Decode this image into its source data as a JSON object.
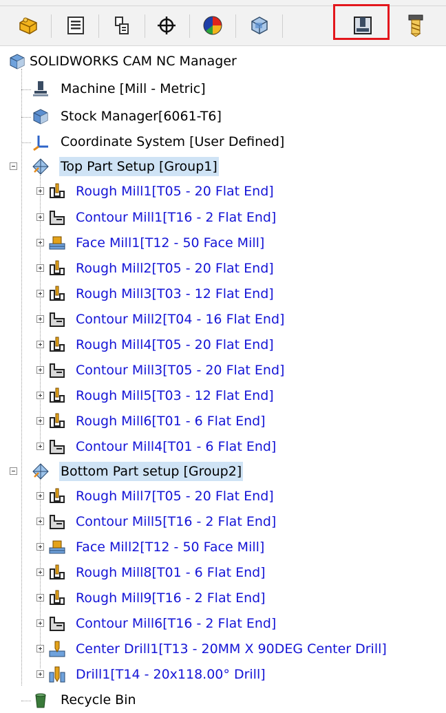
{
  "toolbar": {
    "tabs": [
      {
        "name": "feature-manager-tab",
        "icon": "puzzle-icon",
        "active": false
      },
      {
        "name": "property-manager-tab",
        "icon": "property-list-icon",
        "active": false
      },
      {
        "name": "configuration-manager-tab",
        "icon": "configuration-icon",
        "active": false
      },
      {
        "name": "dimxpert-manager-tab",
        "icon": "crosshair-icon",
        "active": false
      },
      {
        "name": "display-manager-tab",
        "icon": "color-pie-icon",
        "active": false
      },
      {
        "name": "cam-feature-tree-tab",
        "icon": "cam-feature-tree-icon",
        "active": false
      },
      {
        "name": "cam-operation-tree-tab",
        "icon": "cam-operation-tree-icon",
        "active": true
      },
      {
        "name": "cam-tool-tree-tab",
        "icon": "cam-tool-tree-icon",
        "active": false
      }
    ],
    "highlight_color": "#e3161c"
  },
  "tree": {
    "root": {
      "label": "SOLIDWORKS CAM NC Manager",
      "icon": "nc-manager-icon"
    },
    "machine": {
      "label": "Machine [Mill - Metric]",
      "icon": "machine-icon"
    },
    "stock": {
      "label": "Stock Manager[6061-T6]",
      "icon": "stock-icon"
    },
    "coordinate_system": {
      "label": "Coordinate System [User Defined]",
      "icon": "coordinate-system-icon"
    },
    "setups": [
      {
        "label": "Top Part Setup [Group1]",
        "icon": "setup-icon",
        "operations": [
          {
            "label": "Rough Mill1[T05 - 20 Flat End]",
            "icon": "rough-mill-icon"
          },
          {
            "label": "Contour Mill1[T16 - 2 Flat End]",
            "icon": "contour-mill-icon"
          },
          {
            "label": "Face Mill1[T12 - 50 Face Mill]",
            "icon": "face-mill-icon"
          },
          {
            "label": "Rough Mill2[T05 - 20 Flat End]",
            "icon": "rough-mill-icon"
          },
          {
            "label": "Rough Mill3[T03 - 12 Flat End]",
            "icon": "rough-mill-icon"
          },
          {
            "label": "Contour Mill2[T04 - 16 Flat End]",
            "icon": "contour-mill-icon"
          },
          {
            "label": "Rough Mill4[T05 - 20 Flat End]",
            "icon": "rough-mill-icon"
          },
          {
            "label": "Contour Mill3[T05 - 20 Flat End]",
            "icon": "contour-mill-icon"
          },
          {
            "label": "Rough Mill5[T03 - 12 Flat End]",
            "icon": "rough-mill-icon"
          },
          {
            "label": "Rough Mill6[T01 - 6 Flat End]",
            "icon": "rough-mill-icon"
          },
          {
            "label": "Contour Mill4[T01 - 6 Flat End]",
            "icon": "contour-mill-icon"
          }
        ]
      },
      {
        "label": "Bottom Part setup [Group2]",
        "icon": "setup-icon",
        "operations": [
          {
            "label": "Rough Mill7[T05 - 20 Flat End]",
            "icon": "rough-mill-icon"
          },
          {
            "label": "Contour Mill5[T16 - 2 Flat End]",
            "icon": "contour-mill-icon"
          },
          {
            "label": "Face Mill2[T12 - 50 Face Mill]",
            "icon": "face-mill-icon"
          },
          {
            "label": "Rough Mill8[T01 - 6 Flat End]",
            "icon": "rough-mill-icon"
          },
          {
            "label": "Rough Mill9[T16 - 2 Flat End]",
            "icon": "rough-mill-icon"
          },
          {
            "label": "Contour Mill6[T16 - 2 Flat End]",
            "icon": "contour-mill-icon"
          },
          {
            "label": "Center Drill1[T13 - 20MM X 90DEG Center Drill]",
            "icon": "center-drill-icon"
          },
          {
            "label": "Drill1[T14 - 20x118.00° Drill]",
            "icon": "drill-icon"
          }
        ]
      }
    ],
    "recycle_bin": {
      "label": "Recycle Bin",
      "icon": "recycle-bin-icon"
    }
  },
  "colors": {
    "operation_text": "#1414d6",
    "selected_bg": "#cfe3f5"
  }
}
